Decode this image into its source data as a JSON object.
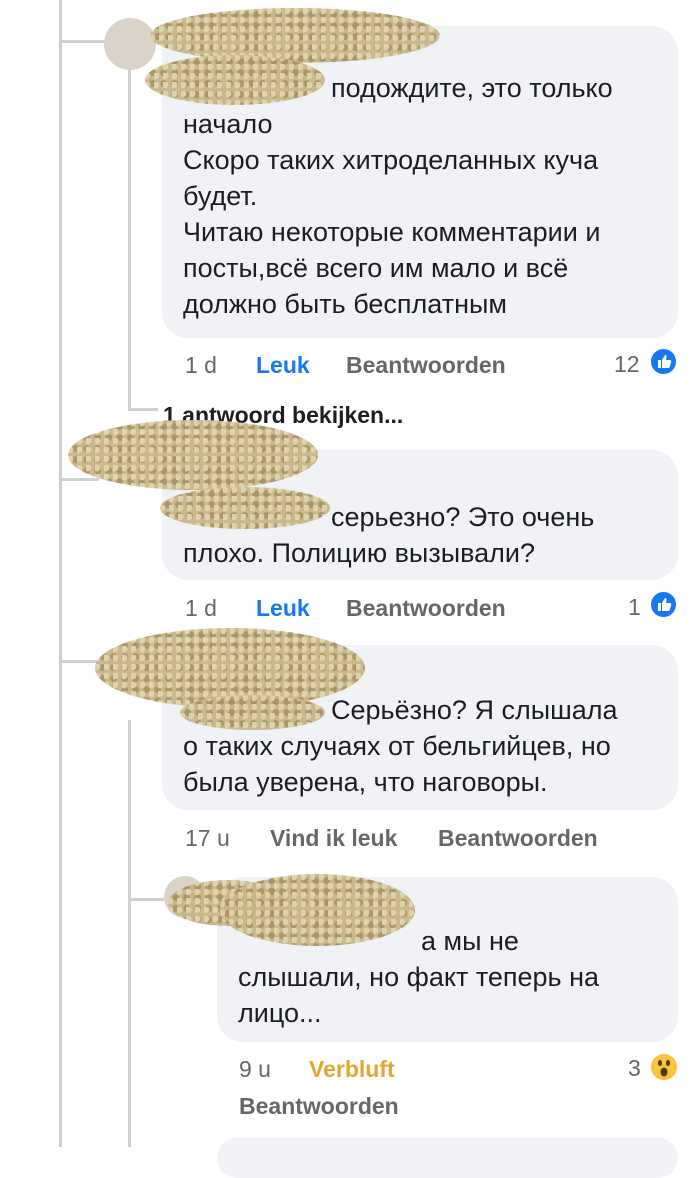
{
  "comments": [
    {
      "text": "подождите, это только\nначало\nСкоро таких хитроделанных куча\nбудет.\nЧитаю некоторые комментарии и\nпосты,всё всего им мало и всё\nдолжно быть бесплатным",
      "time": "1 d",
      "like_label": "Leuk",
      "reply_label": "Beantwoorden",
      "reaction_count": "12"
    },
    {
      "text": "серьезно? Это очень\nплохо. Полицию вызывали?",
      "time": "1 d",
      "like_label": "Leuk",
      "reply_label": "Beantwoorden",
      "reaction_count": "1"
    },
    {
      "text": "Серьёзно? Я слышала\nо таких случаях от бельгийцев, но\nбыла уверена, что наговоры.",
      "time": "17 u",
      "like_label": "Vind ik leuk",
      "reply_label": "Beantwoorden"
    },
    {
      "text": "а мы не\nслышали, но факт теперь на\nлицо...",
      "time": "9 u",
      "reaction_label": "Verbluft",
      "reply_label": "Beantwoorden",
      "reaction_count": "3"
    }
  ],
  "view_replies": "1 antwoord bekijken...",
  "colors": {
    "bubble": "#f0f2f5",
    "link_blue": "#1877f2",
    "meta_gray": "#65676b",
    "wow": "#e2a72e"
  },
  "icons": [
    "like-icon",
    "wow-icon"
  ]
}
